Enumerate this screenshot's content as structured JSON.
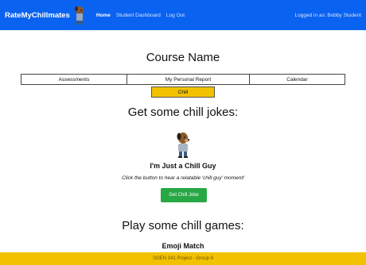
{
  "navbar": {
    "brand": "RateMyChillmates",
    "links": [
      "Home",
      "Student Dashboard",
      "Log Out"
    ],
    "logged_in": "Logged in as: Bobby Student"
  },
  "course": {
    "title": "Course Name"
  },
  "tabs": [
    "Assessments",
    "My Personal Report",
    "Calendar"
  ],
  "chill_tab": "Chill",
  "jokes": {
    "title": "Get some chill jokes:",
    "character_title": "I'm Just a Chill Guy",
    "description": "Click the button to hear a relatable 'chill guy' moment!",
    "button_label": "Get Chill Joke"
  },
  "games": {
    "title": "Play some chill games:",
    "first_game": "Emoji Match"
  },
  "footer": {
    "text": "SOEN 341 Project - Group 6"
  },
  "colors": {
    "navbar": "#0a62f0",
    "accent": "#f2c100",
    "button": "#28a745"
  }
}
